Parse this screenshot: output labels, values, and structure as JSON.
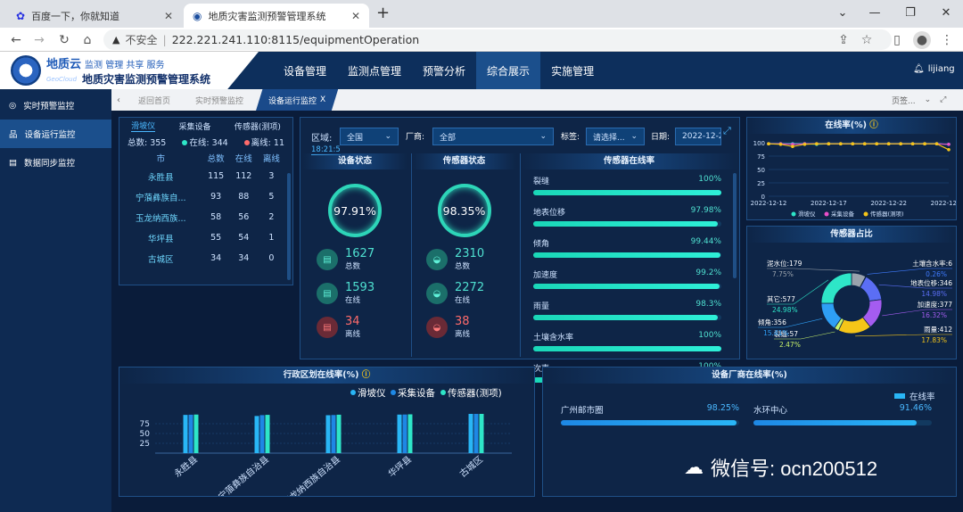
{
  "browser": {
    "tabs": [
      {
        "title": "百度一下，你就知道"
      },
      {
        "title": "地质灾害监测预警管理系统"
      }
    ],
    "insecure_label": "不安全",
    "url": "222.221.241.110:8115/equipmentOperation"
  },
  "app": {
    "logo_brand": "地质云",
    "logo_sub": "GeoCloud",
    "logo_tagline": "监测 管理 共享 服务",
    "title": "地质灾害监测预警管理系统",
    "nav": [
      "设备管理",
      "监测点管理",
      "预警分析",
      "综合展示",
      "实施管理"
    ],
    "nav_active": 3,
    "user": "lijiang"
  },
  "sidebar": {
    "items": [
      "实时预警监控",
      "设备运行监控",
      "数据同步监控"
    ],
    "active": 1
  },
  "page_tabs": {
    "items": [
      "返回首页",
      "实时预警监控",
      "设备运行监控"
    ],
    "active": 2,
    "close": "X",
    "right_label": "页签..."
  },
  "region_table": {
    "tabs": [
      "滑坡仪",
      "采集设备",
      "传感器(测项)"
    ],
    "summary": {
      "total_label": "总数:",
      "total": "355",
      "online_label": "在线:",
      "online": "344",
      "offline_label": "离线:",
      "offline": "11"
    },
    "headers": [
      "市",
      "总数",
      "在线",
      "离线"
    ],
    "rows": [
      [
        "永胜县",
        "115",
        "112",
        "3"
      ],
      [
        "宁蒗彝族自...",
        "93",
        "88",
        "5"
      ],
      [
        "玉龙纳西族...",
        "58",
        "56",
        "2"
      ],
      [
        "华坪县",
        "55",
        "54",
        "1"
      ],
      [
        "古城区",
        "34",
        "34",
        "0"
      ]
    ]
  },
  "filters": {
    "region_label": "区域:",
    "region_value": "全国",
    "vendor_label": "厂商:",
    "vendor_value": "全部",
    "tag_label": "标签:",
    "tag_value": "请选择...",
    "date_label": "日期:",
    "date_value": "2022-12-2",
    "time": "18:21:5"
  },
  "device_status": {
    "title": "设备状态",
    "rate": "97.91%",
    "total": "1627",
    "total_label": "总数",
    "online": "1593",
    "online_label": "在线",
    "offline": "34",
    "offline_label": "离线"
  },
  "sensor_status": {
    "title": "传感器状态",
    "rate": "98.35%",
    "total": "2310",
    "total_label": "总数",
    "online": "2272",
    "online_label": "在线",
    "offline": "38",
    "offline_label": "离线"
  },
  "sensor_online": {
    "title": "传感器在线率",
    "items": [
      {
        "name": "裂缝",
        "pct": "100%",
        "value": 100
      },
      {
        "name": "地表位移",
        "pct": "97.98%",
        "value": 97.98
      },
      {
        "name": "倾角",
        "pct": "99.44%",
        "value": 99.44
      },
      {
        "name": "加速度",
        "pct": "99.2%",
        "value": 99.2
      },
      {
        "name": "雨量",
        "pct": "98.3%",
        "value": 98.3
      },
      {
        "name": "土壤含水率",
        "pct": "100%",
        "value": 100
      },
      {
        "name": "次声",
        "pct": "100%",
        "value": 100
      }
    ]
  },
  "online_rate": {
    "title": "在线率(%)",
    "chart_data": {
      "type": "line",
      "x": [
        "2022-12-12",
        "2022-12-13",
        "2022-12-14",
        "2022-12-15",
        "2022-12-16",
        "2022-12-17",
        "2022-12-18",
        "2022-12-19",
        "2022-12-20",
        "2022-12-21",
        "2022-12-22",
        "2022-12-23",
        "2022-12-24",
        "2022-12-25",
        "2022-12-26",
        "2022-12-27"
      ],
      "x_ticks": [
        "2022-12-12",
        "2022-12-17",
        "2022-12-22",
        "2022-12-27"
      ],
      "y_ticks": [
        "0",
        "25",
        "50",
        "75",
        "100"
      ],
      "ylim": [
        0,
        100
      ],
      "series": [
        {
          "name": "滑坡仪",
          "color": "#2ee6c8",
          "values": [
            98,
            98,
            98,
            98,
            97,
            98,
            98,
            98,
            98,
            98,
            98,
            98,
            98,
            98,
            98,
            97
          ]
        },
        {
          "name": "采集设备",
          "color": "#e84ec8",
          "values": [
            98,
            98,
            97,
            98,
            98,
            98,
            98,
            98,
            98,
            98,
            98,
            98,
            98,
            98,
            98,
            97
          ]
        },
        {
          "name": "传感器(测项)",
          "color": "#f5c518",
          "values": [
            98,
            97,
            93,
            97,
            98,
            98,
            98,
            98,
            98,
            98,
            98,
            98,
            98,
            98,
            98,
            87
          ]
        }
      ],
      "grid": true,
      "legend": "bottom"
    }
  },
  "sensor_share": {
    "title": "传感器占比",
    "chart_data": {
      "type": "pie",
      "categories": [
        "泥水位",
        "土壤含水率",
        "地表位移",
        "加速度",
        "雨量",
        "裂缝",
        "倾角",
        "其它"
      ],
      "values": [
        179,
        6,
        346,
        377,
        412,
        57,
        356,
        577
      ],
      "labels": [
        {
          "name": "泥水位:179",
          "pct": "7.75%"
        },
        {
          "name": "土壤含水率:6",
          "pct": "0.26%"
        },
        {
          "name": "地表位移:346",
          "pct": "14.98%"
        },
        {
          "name": "加速度:377",
          "pct": "16.32%"
        },
        {
          "name": "雨量:412",
          "pct": "17.83%"
        },
        {
          "name": "裂缝:57",
          "pct": "2.47%"
        },
        {
          "name": "倾角:356",
          "pct": "15.41%"
        },
        {
          "name": "其它:577",
          "pct": "24.98%"
        }
      ],
      "colors": [
        "#9aa3ad",
        "#3f7bff",
        "#5b6ef5",
        "#a45cf0",
        "#f5c518",
        "#c8f26a",
        "#2e9ff5",
        "#2ee6c8"
      ]
    }
  },
  "district_rate": {
    "title": "行政区划在线率(%)",
    "chart_data": {
      "type": "bar",
      "categories": [
        "永胜县",
        "宁蒗彝族自治县",
        "玉龙纳西族自治县",
        "华坪县",
        "古城区"
      ],
      "series": [
        {
          "name": "滑坡仪",
          "color": "#29b6f6",
          "values": [
            97.4,
            94.6,
            96.6,
            98.2,
            100
          ]
        },
        {
          "name": "采集设备",
          "color": "#1e88e5",
          "values": [
            97.9,
            96.8,
            97.1,
            98.4,
            100
          ]
        },
        {
          "name": "传感器(测项)",
          "color": "#2ee6c8",
          "values": [
            98.3,
            97.5,
            97.9,
            98.9,
            100
          ]
        }
      ],
      "y_ticks": [
        "25",
        "50",
        "75"
      ],
      "ylim": [
        0,
        100
      ],
      "legend": "top-right"
    }
  },
  "vendor_rate": {
    "title": "设备厂商在线率(%)",
    "legend": "在线率",
    "items": [
      {
        "name": "广州邮市圈",
        "pct": "98.25%",
        "value": 98.25
      },
      {
        "name": "水环中心",
        "pct": "91.46%",
        "value": 91.46
      }
    ]
  },
  "watermark": "微信号: ocn200512"
}
